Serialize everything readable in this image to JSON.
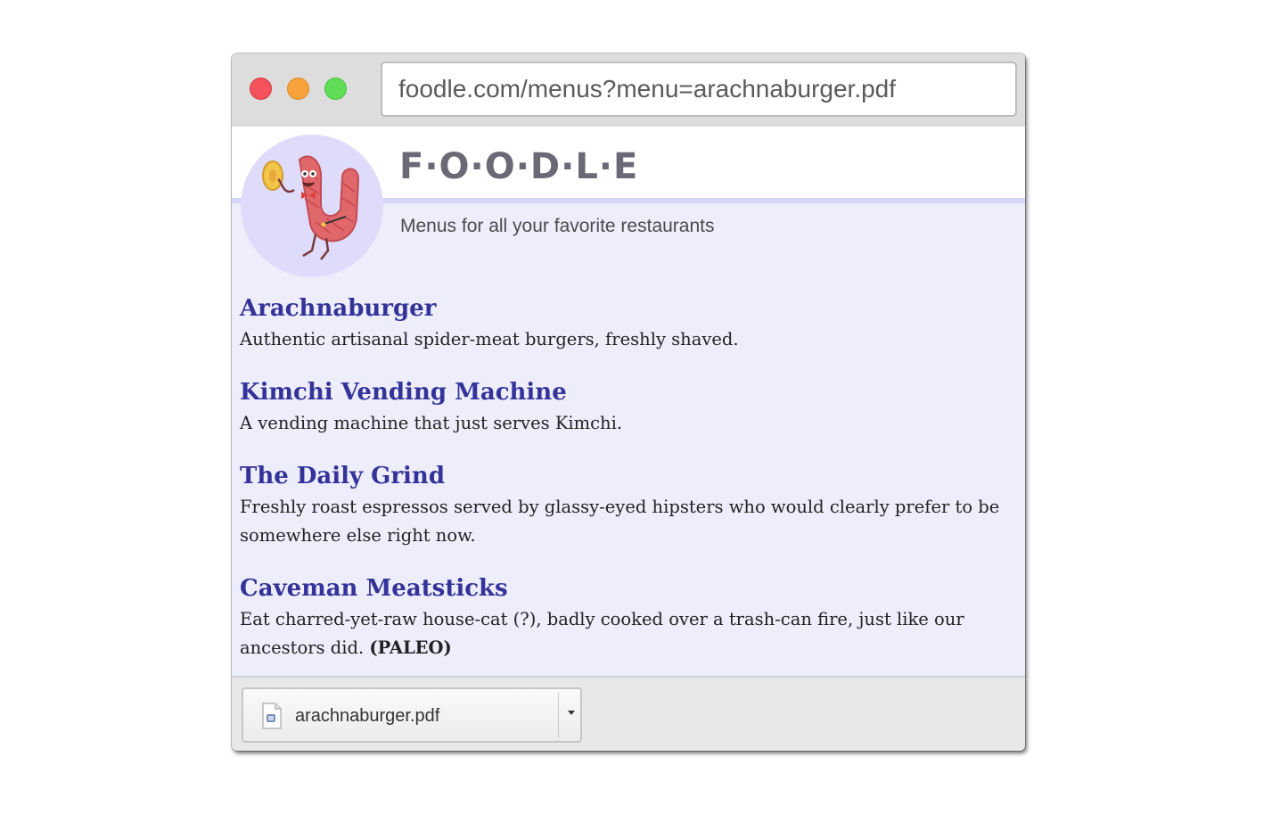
{
  "browser": {
    "url": "foodle.com/menus?menu=arachnaburger.pdf",
    "controls": [
      "close-icon",
      "minimize-icon",
      "maximize-icon"
    ]
  },
  "site": {
    "brand": "F·O·O·D·L·E",
    "tagline": "Menus for all your favorite restaurants"
  },
  "restaurants": [
    {
      "name": "Arachnaburger",
      "description": "Authentic artisanal spider-meat burgers, freshly shaved."
    },
    {
      "name": "Kimchi Vending Machine",
      "description": "A vending machine that just serves Kimchi."
    },
    {
      "name": "The Daily Grind",
      "description": "Freshly roast espressos served by glassy-eyed hipsters who would clearly prefer to be somewhere else right now."
    },
    {
      "name": "Caveman Meatsticks",
      "description": "Eat charred-yet-raw house-cat (?), badly cooked over a trash-can fire, just like our ancestors did.",
      "tag": "(PALEO)"
    }
  ],
  "download": {
    "filename": "arachnaburger.pdf",
    "icon": "pdf-file-icon",
    "menu_icon": "dropdown-arrow-icon"
  },
  "colors": {
    "link": "#333399",
    "page_bg": "#eeedfc",
    "brand_text": "#6a6a76"
  }
}
